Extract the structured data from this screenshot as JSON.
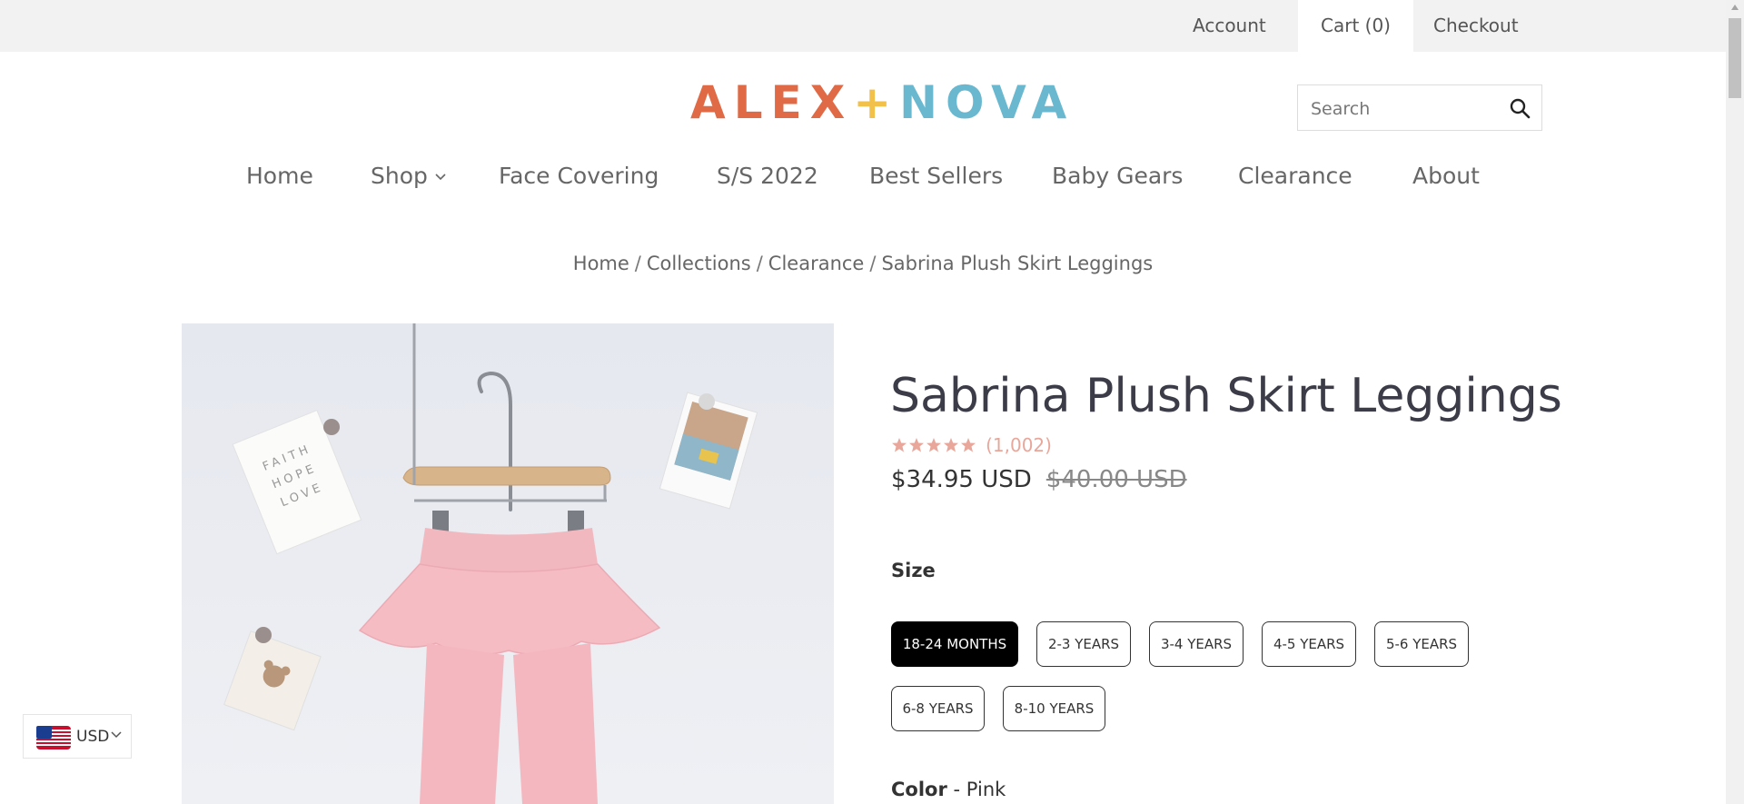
{
  "topbar": {
    "links": [
      {
        "label": "Account"
      },
      {
        "label": "Cart (0)"
      },
      {
        "label": "Checkout"
      }
    ]
  },
  "logo": {
    "left": "ALEX",
    "plus": "+",
    "right": "NOVA"
  },
  "search": {
    "placeholder": "Search",
    "icon": "search-icon"
  },
  "nav": {
    "items": [
      {
        "label": "Home"
      },
      {
        "label": "Shop"
      },
      {
        "label": "Face Covering"
      },
      {
        "label": "S/S 2022"
      },
      {
        "label": "Best Sellers"
      },
      {
        "label": "Baby Gears"
      },
      {
        "label": "Clearance"
      },
      {
        "label": "About"
      }
    ]
  },
  "breadcrumb": {
    "items": [
      "Home",
      "Collections",
      "Clearance",
      "Sabrina Plush Skirt Leggings"
    ],
    "separator": "/"
  },
  "product": {
    "title": "Sabrina Plush Skirt Leggings",
    "rating_stars": 5,
    "rating_count": "(1,002)",
    "price": "$34.95 USD",
    "compare_price": "$40.00 USD",
    "size_label": "Size",
    "sizes": [
      "18-24 MONTHS",
      "2-3 YEARS",
      "3-4 YEARS",
      "4-5 YEARS",
      "5-6 YEARS",
      "6-8 YEARS",
      "8-10 YEARS"
    ],
    "selected_size": "18-24 MONTHS",
    "color_label": "Color",
    "color_separator": "-",
    "color_value": "Pink"
  },
  "image_cards": {
    "faith_card": [
      "FAITH",
      "HOPE",
      "LOVE"
    ]
  },
  "currency": {
    "code": "USD",
    "flag": "us-flag-icon"
  },
  "colors": {
    "logo_orange": "#e06a45",
    "logo_yellow": "#f1c14c",
    "logo_blue": "#6ab8cf",
    "selected_size_bg": "#000000",
    "rating_color": "#e8a79a"
  }
}
